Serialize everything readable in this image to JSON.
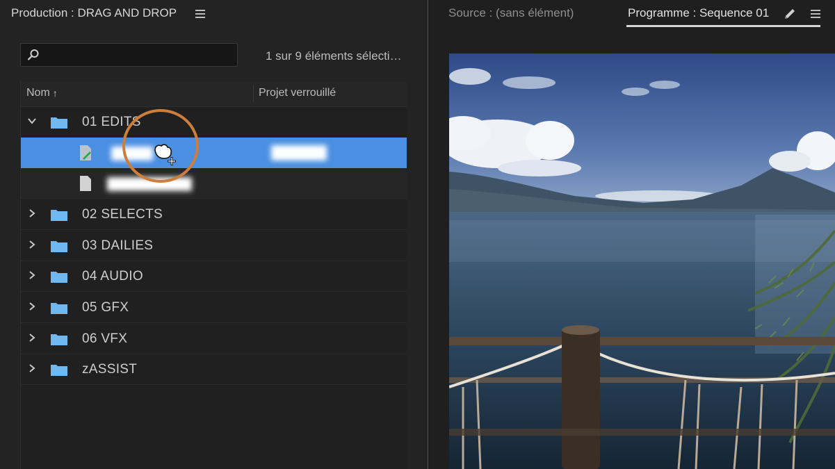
{
  "project_panel": {
    "title": "Production : DRAG AND DROP",
    "search": {
      "value": "",
      "placeholder": ""
    },
    "selection_count": "1 sur 9 éléments sélecti…",
    "columns": {
      "name": "Nom",
      "locked": "Projet verrouillé"
    },
    "folders": [
      {
        "label": "01 EDITS",
        "expanded": true
      },
      {
        "label": "02 SELECTS",
        "expanded": false
      },
      {
        "label": "03 DAILIES",
        "expanded": false
      },
      {
        "label": "04 AUDIO",
        "expanded": false
      },
      {
        "label": "05 GFX",
        "expanded": false
      },
      {
        "label": "06 VFX",
        "expanded": false
      },
      {
        "label": "zASSIST",
        "expanded": false
      }
    ]
  },
  "monitor_panel": {
    "source_tab": "Source : (sans élément)",
    "program_tab": "Programme : Sequence 01"
  },
  "colors": {
    "selection": "#4a8fe2",
    "folder": "#6fb8f0",
    "highlight_ring": "#cc7e3c"
  },
  "icons": [
    "menu-icon",
    "search-icon",
    "sort-up-icon",
    "chevron-down-icon",
    "chevron-right-icon",
    "folder-icon",
    "sequence-icon",
    "file-icon",
    "pencil-icon",
    "grab-cursor-icon"
  ]
}
